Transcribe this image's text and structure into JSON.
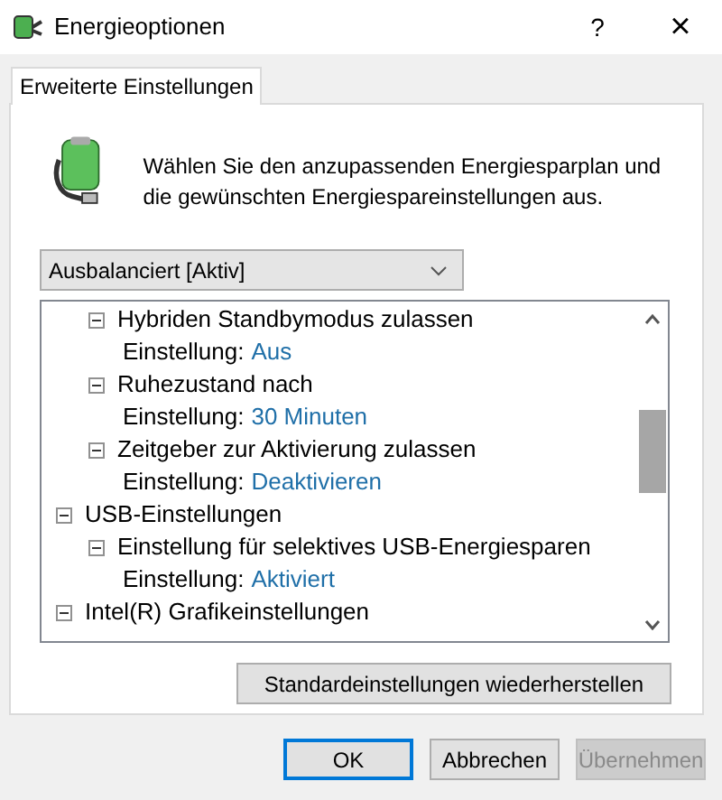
{
  "window": {
    "title": "Energieoptionen",
    "help": "?",
    "close": "×"
  },
  "tabs": [
    {
      "label": "Erweiterte Einstellungen",
      "selected": true
    }
  ],
  "intro": "Wählen Sie den anzupassenden Energiesparplan und die gewünschten Energiespareinstellungen aus.",
  "plan_dropdown": {
    "value": "Ausbalanciert [Aktiv]"
  },
  "tree": {
    "continued_items": [
      {
        "label": "Hybriden Standbymodus zulassen",
        "expanded": true,
        "children": [
          {
            "kind": "setting",
            "label": "Einstellung:",
            "value": "Aus"
          }
        ]
      },
      {
        "label": "Ruhezustand nach",
        "expanded": true,
        "children": [
          {
            "kind": "setting",
            "label": "Einstellung:",
            "value": "30 Minuten"
          }
        ]
      },
      {
        "label": "Zeitgeber zur Aktivierung zulassen",
        "expanded": true,
        "children": [
          {
            "kind": "setting",
            "label": "Einstellung:",
            "value": "Deaktivieren"
          }
        ]
      }
    ],
    "items": [
      {
        "label": "USB-Einstellungen",
        "expanded": true,
        "children": [
          {
            "label": "Einstellung für selektives USB-Energiesparen",
            "expanded": true,
            "children": [
              {
                "kind": "setting",
                "label": "Einstellung:",
                "value": "Aktiviert"
              }
            ]
          }
        ]
      },
      {
        "label": "Intel(R) Grafikeinstellungen",
        "expanded": true
      }
    ]
  },
  "restore_button": "Standardeinstellungen wiederherstellen",
  "buttons": [
    {
      "label": "OK",
      "default": true,
      "disabled": false
    },
    {
      "label": "Abbrechen",
      "default": false,
      "disabled": false
    },
    {
      "label": "Übernehmen",
      "default": false,
      "disabled": true
    }
  ]
}
